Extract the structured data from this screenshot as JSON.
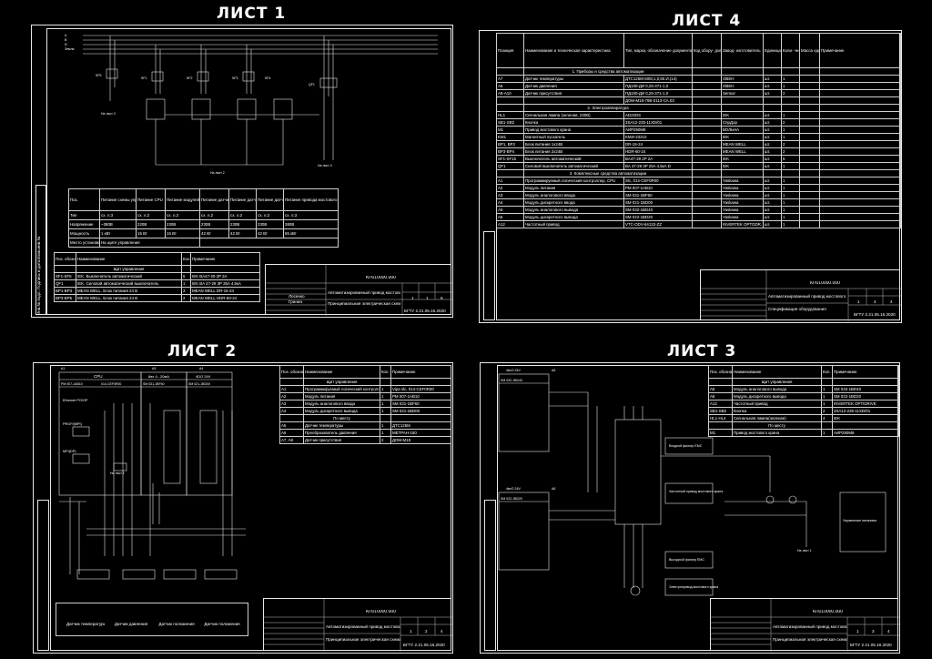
{
  "sheets": {
    "s1": {
      "title": "ЛИСТ 1",
      "top_bus_labels": [
        "A",
        "B",
        "N",
        "Земля"
      ],
      "breakers": [
        "SF5",
        "SF1",
        "SF2",
        "SF3",
        "SF4",
        "QF1"
      ],
      "note_list3": "На лист 3",
      "note_list2": "На лист 2",
      "note_list3b": "На лист 3",
      "power_table": {
        "headers": [
          "Поз.",
          "Питание схемы управления",
          "Питание CPU",
          "Питание модулей",
          "Питание датчиков",
          "Питание датчиков",
          "Питание датчиков",
          "Питание привода мостового крана"
        ],
        "rows": [
          [
            "Тип",
            "сх. л.3",
            "сх. л.2",
            "сх. л.2",
            "сх. л.2",
            "сх. л.2",
            "сх. л.2",
            "сх. л.3"
          ],
          [
            "Напряжение",
            "~380В",
            "220В",
            "230В",
            "230В",
            "230В",
            "230В",
            "380В"
          ],
          [
            "Мощность",
            "1 кВт",
            "15 Вт",
            "15 Вт",
            "42 Вт",
            "42 Вт",
            "42 Вт",
            "55 кВт"
          ],
          [
            "Место установки",
            "На щите управления",
            "",
            "",
            "",
            "По месту",
            "",
            ""
          ]
        ]
      },
      "spec_table": {
        "headers": [
          "Поз. обозна- чение",
          "Наименование",
          "Кол.",
          "Примечание"
        ],
        "section": "Щит управления",
        "rows": [
          [
            "SF1-SF5",
            "IEK. Выключатель автоматический",
            "5",
            "IEK BA47-29 2P 2A"
          ],
          [
            "QF1",
            "IEK. Силовой автоматический выключатель",
            "1",
            "IEK BA 47-29 3P 25A 4,5кА"
          ],
          [
            "BP1-BP3",
            "MEAN WELL. Блок питания 24 В",
            "3",
            "MEAN WELL DR-15-24"
          ],
          [
            "BP3-BP5",
            "MEAN WELL. Блок питания 24 В",
            "2",
            "MEAN WELL HDR-60-24"
          ]
        ]
      },
      "stamp": {
        "code": "КП010000.000",
        "title": "Автоматизированный привод мостового крана",
        "subtitle": "Принципиальная электрическая схема",
        "stage_label": "Стадия",
        "sheet_label": "Лист",
        "sheets_label": "Листов",
        "stage": "1",
        "sheet": "1",
        "sheets": "6",
        "org": "БГТУ 2.21.05.16.2020",
        "rows_labels": [
          "Изм.",
          "Разраб.",
          "Пров.",
          "",
          "Утв."
        ],
        "names": [
          "Лист",
          "№ докум.",
          "Подпись",
          "Дата"
        ],
        "developer": "Лосенко",
        "checker": "Гринин"
      },
      "side_labels": [
        "Инв.№ подл.",
        "Подпись и дата",
        "Взам.инв.№",
        "Подпись и дата",
        "Инв.№ дубл."
      ],
      "side_vertical": "Справочный №"
    },
    "s2": {
      "title": "ЛИСТ 2",
      "blocks": [
        {
          "name": "CPU",
          "tag": "A1"
        },
        {
          "name": "8вх 4...20мА",
          "tag": "A3"
        },
        {
          "name": "4DO 24V",
          "tag": "A4"
        }
      ],
      "cpu_model": "PM 007-1AB10",
      "cpu_model2": "014-CEF0R00",
      "ai_model": "SM 031-1BF60",
      "do_model": "SM 021-1BD00",
      "ports": [
        "Ethernet PG/OP",
        "PROFI(MPI)",
        "MPI(DP)"
      ],
      "note_list1": "На лист 1",
      "sensors": [
        "Датчик температуры",
        "Датчик давления",
        "Датчик положения",
        "Датчик положения"
      ],
      "spec_table": {
        "headers": [
          "Поз. обозна- чение",
          "Наименование",
          "Кол.",
          "Примечание"
        ],
        "section1": "Щит управления",
        "rows1": [
          [
            "A1",
            "Программируемый логический контроллер, CPU",
            "1",
            "Vipa slc, 014-CEF0R00"
          ],
          [
            "A2",
            "Модуль питания",
            "1",
            "PM 007-1AB10"
          ],
          [
            "A3",
            "Модуль аналогового ввода",
            "1",
            "SM 031-1BF60"
          ],
          [
            "A4",
            "Модуль дискретного вывода",
            "1",
            "SM 021-1BD00"
          ]
        ],
        "section2": "По месту",
        "rows2": [
          [
            "A5",
            "Датчик температуры",
            "1",
            "ДТС125М"
          ],
          [
            "A6",
            "Преобразователь давления",
            "1",
            "МЕТРАН-150"
          ],
          [
            "A7, A8",
            "Датчик присутствия",
            "2",
            "ДОМ-М18"
          ]
        ]
      },
      "stamp": {
        "code": "КП010000.000",
        "title": "Автоматизированный привод мостового крана",
        "subtitle": "Принципиальная электрическая схема",
        "stage": "1",
        "sheet": "2",
        "sheets": "4",
        "org": "БГТУ 2.21.05.16.2020"
      }
    },
    "s3": {
      "title": "ЛИСТ 3",
      "blocks": [
        {
          "name": "4вхО 24V",
          "tag": "A5"
        },
        {
          "name": "SM 032-1BD40",
          "tag": "A5"
        },
        {
          "name": "4вхО 24V",
          "tag": "A6"
        },
        {
          "name": "SM 022-1BD20",
          "tag": "A6"
        }
      ],
      "elements": [
        "Входной фильтр EMC",
        "Частотный привод мостового крана",
        "Выходной фильтр EMC",
        "Электропривод мостового крана"
      ],
      "control_panel": "Управление питанием",
      "note_list1": "На лист 1",
      "spec_table": {
        "headers": [
          "Поз. обозна- чение",
          "Наименование",
          "Кол.",
          "Примечание"
        ],
        "section1": "Щит управления",
        "rows1": [
          [
            "A5",
            "Модуль аналогового вывода",
            "1",
            "SM 032-1BD40"
          ],
          [
            "A6",
            "Модуль дискретного вывода",
            "1",
            "SM 022-1BD20"
          ],
          [
            "A12",
            "Частотный привод",
            "1",
            "INVERTEK OPTIDRIVE"
          ],
          [
            "SB1-SB2",
            "Кнопка",
            "2",
            "3SA12-225-11XD/01"
          ],
          [
            "HL1-HL4",
            "Сигнальная лампа(зеленая)",
            "4",
            "IEK"
          ]
        ],
        "section2": "По месту",
        "rows2": [
          [
            "M1",
            "Привод мостового крана",
            "1",
            "AИР250M6"
          ]
        ]
      },
      "stamp": {
        "code": "КП010000.000",
        "title": "Автоматизированный привод мостового крана",
        "subtitle": "Принципиальная электрическая схема",
        "stage": "1",
        "sheet": "3",
        "sheets": "4",
        "org": "БГТУ 2.21.05.16.2020"
      }
    },
    "s4": {
      "title": "ЛИСТ 4",
      "headers": [
        "Позиция",
        "Наименование и техническая характеристика",
        "Тип, марка, обозначение документа опросного листа",
        "Код обору- дования, изделий и материалов",
        "Завод- изготовитель",
        "Единица изме- рения",
        "Коли- чество",
        "Масса единицы кг",
        "Примечание"
      ],
      "sections": [
        {
          "name": "1. Приборы и средства автоматизации",
          "rows": [
            [
              "A7",
              "Датчик температуры",
              "ДТС125М-50М,1,0,60.И.(14)",
              "",
              "ОВЕН",
              "шт.",
              "1"
            ],
            [
              "A6",
              "Датчик давления",
              "ПД100-ДИ 0,25-371-1,0",
              "",
              "ОВЕН",
              "шт.",
              "1"
            ],
            [
              "A9-A10",
              "Датчик присутствия",
              "ПД100-ДИ 0,25-371-1,0",
              "",
              "Sensor",
              "шт.",
              "2"
            ],
            [
              "",
              "",
              "ДОМ-М18-76В-0113-СА.03",
              "",
              "",
              "",
              ""
            ]
          ]
        },
        {
          "name": "2. Электроаппаратура",
          "rows": [
            [
              "HL1",
              "Сигнальная лампа (зеленая, 230В)",
              "AD22DS",
              "",
              "IEK",
              "шт.",
              "1"
            ],
            [
              "SB1-SB2",
              "Кнопка",
              "3SA12-225-11XD/01",
              "",
              "СпрДор",
              "шт.",
              "2"
            ],
            [
              "M1",
              "Привод мостового крана",
              "AИР250M6",
              "",
              "ВОЛЬНА",
              "шт.",
              "1"
            ],
            [
              "KM1",
              "Магнитный пускатель",
              "KMИ-23210",
              "",
              "IEK",
              "шт.",
              "1"
            ],
            [
              "BP1, BP2",
              "Блок питания 1x24В",
              "DR-15-24",
              "",
              "MEAN WELL",
              "шт.",
              "2"
            ],
            [
              "BP3-BP4",
              "Блок питания 2x24В",
              "HDR-60-24",
              "",
              "MEAN WELL",
              "шт.",
              "2"
            ],
            [
              "SF1-SF15",
              "Выключатель автоматический",
              "BA47-29 2P 2A",
              "",
              "IEK",
              "шт.",
              "5"
            ],
            [
              "QF1",
              "Силовой выключатель автоматический",
              "BA 47-29 3P 25A 4,5кА D",
              "",
              "IEK",
              "шт.",
              "1"
            ]
          ]
        },
        {
          "name": "3. Комплексные средства автоматизации",
          "rows": [
            [
              "A1",
              "Программируемый логический контроллер, CPU",
              "Slc, 014-CEF0R00",
              "",
              "Yaskawa",
              "шт.",
              "1"
            ],
            [
              "A2",
              "Модуль питания",
              "PM 007-1AB10",
              "",
              "Yaskawa",
              "шт.",
              "1"
            ],
            [
              "A3",
              "Модуль аналогового ввода",
              "SM 031-1BF60",
              "",
              "Yaskawa",
              "шт.",
              "1"
            ],
            [
              "A4",
              "Модуль дискретного ввода",
              "SM 021-1BD00",
              "",
              "Yaskawa",
              "шт.",
              "1"
            ],
            [
              "A5",
              "Модуль аналогового вывода",
              "SM 032-1BD40",
              "",
              "Yaskawa",
              "шт.",
              "1"
            ],
            [
              "A6",
              "Модуль дискретного вывода",
              "SM 022-1BD20",
              "",
              "Yaskawa",
              "шт.",
              "1"
            ],
            [
              "A12",
              "Частотный привод",
              "VTC-ODV-64132-ZZ",
              "",
              "INVERTEK OPTODR.",
              "шт.",
              "1"
            ]
          ]
        }
      ],
      "stamp": {
        "code": "КП010000.000",
        "title": "Автоматизированный привод мостового крана",
        "subtitle": "Спецификация оборудования",
        "stage": "1",
        "sheet": "4",
        "sheets": "4",
        "org": "БГТУ 2.21.05.16.2020"
      }
    }
  }
}
